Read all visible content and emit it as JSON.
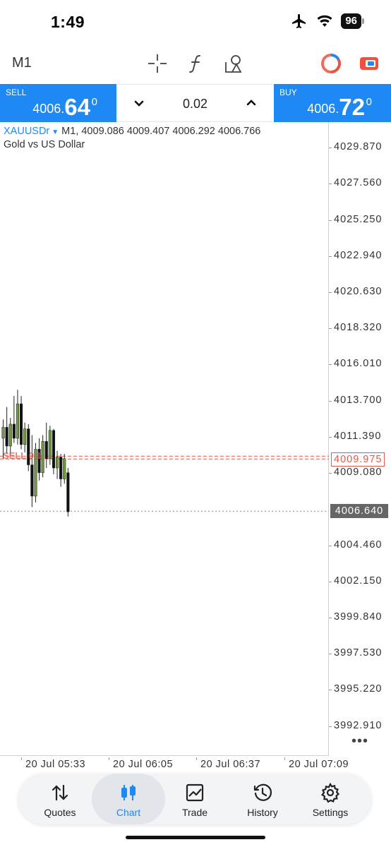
{
  "status_bar": {
    "time": "1:49",
    "battery": "96"
  },
  "toolbar": {
    "timeframe": "M1"
  },
  "trade_panel": {
    "sell": {
      "label": "SELL",
      "price_main": "4006.",
      "price_big": "64",
      "price_sup": "0"
    },
    "buy": {
      "label": "BUY",
      "price_main": "4006.",
      "price_big": "72",
      "price_sup": "0"
    },
    "volume": "0.02"
  },
  "chart": {
    "symbol": "XAUUSDr",
    "ohlc_line": "M1, 4009.086 4009.407 4006.292 4006.766",
    "description": "Gold vs US Dollar",
    "price_axis": [
      "4029.870",
      "4027.560",
      "4025.250",
      "4022.940",
      "4020.630",
      "4018.320",
      "4016.010",
      "4013.700",
      "4011.390",
      "4009.080",
      "4004.460",
      "4002.150",
      "3999.840",
      "3997.530",
      "3995.220",
      "3992.910"
    ],
    "order_label": "SELL 0.1",
    "order_price": "4009.975",
    "bid_price": "4006.640",
    "more": "•••",
    "time_axis": [
      "20 Jul 05:33",
      "20 Jul 06:05",
      "20 Jul 06:37",
      "20 Jul 07:09"
    ],
    "colors": {
      "bull": "#6f9a3a",
      "bear": "#111111",
      "order_line": "#e05a4c",
      "bid_line": "#888888",
      "accent": "#1e88f5"
    }
  },
  "chart_data": {
    "type": "candlestick",
    "timeframe": "M1",
    "ylim": [
      3991.0,
      4031.5
    ],
    "candles": [
      {
        "o": 4011.3,
        "h": 4012.5,
        "l": 4010.0,
        "c": 4012.0
      },
      {
        "o": 4012.0,
        "h": 4013.3,
        "l": 4010.3,
        "c": 4010.8
      },
      {
        "o": 4010.8,
        "h": 4012.6,
        "l": 4010.2,
        "c": 4012.2
      },
      {
        "o": 4012.2,
        "h": 4014.0,
        "l": 4011.0,
        "c": 4011.3
      },
      {
        "o": 4011.3,
        "h": 4014.4,
        "l": 4010.9,
        "c": 4013.5
      },
      {
        "o": 4013.5,
        "h": 4014.0,
        "l": 4010.6,
        "c": 4010.9
      },
      {
        "o": 4010.9,
        "h": 4012.3,
        "l": 4010.4,
        "c": 4011.9
      },
      {
        "o": 4011.9,
        "h": 4012.2,
        "l": 4009.2,
        "c": 4009.6
      },
      {
        "o": 4009.6,
        "h": 4011.5,
        "l": 4006.9,
        "c": 4007.6
      },
      {
        "o": 4007.6,
        "h": 4011.0,
        "l": 4007.2,
        "c": 4010.6
      },
      {
        "o": 4010.6,
        "h": 4011.3,
        "l": 4008.6,
        "c": 4009.1
      },
      {
        "o": 4009.1,
        "h": 4011.5,
        "l": 4008.8,
        "c": 4011.1
      },
      {
        "o": 4011.1,
        "h": 4012.3,
        "l": 4009.4,
        "c": 4010.0
      },
      {
        "o": 4010.0,
        "h": 4012.1,
        "l": 4009.6,
        "c": 4011.8
      },
      {
        "o": 4011.8,
        "h": 4011.9,
        "l": 4009.0,
        "c": 4009.4
      },
      {
        "o": 4009.4,
        "h": 4010.5,
        "l": 4008.7,
        "c": 4010.1
      },
      {
        "o": 4010.1,
        "h": 4010.3,
        "l": 4008.2,
        "c": 4008.7
      },
      {
        "o": 4008.7,
        "h": 4010.3,
        "l": 4008.4,
        "c": 4010.0
      },
      {
        "o": 4009.1,
        "h": 4009.4,
        "l": 4006.3,
        "c": 4006.6
      }
    ],
    "lines": [
      {
        "name": "SELL 0.1",
        "value": 4009.975,
        "style": "dashed",
        "color": "#e05a4c"
      },
      {
        "name": "bid",
        "value": 4006.64,
        "style": "dotted",
        "color": "#888888"
      }
    ]
  },
  "nav": {
    "items": [
      {
        "label": "Quotes",
        "icon": "quotes-icon",
        "active": false
      },
      {
        "label": "Chart",
        "icon": "chart-icon",
        "active": true
      },
      {
        "label": "Trade",
        "icon": "trade-icon",
        "active": false
      },
      {
        "label": "History",
        "icon": "history-icon",
        "active": false
      },
      {
        "label": "Settings",
        "icon": "settings-icon",
        "active": false
      }
    ]
  }
}
